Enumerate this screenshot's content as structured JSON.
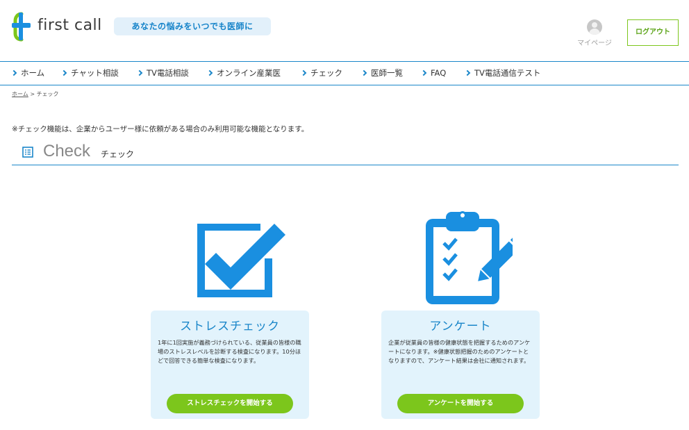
{
  "header": {
    "logo_text": "first call",
    "tagline": "あなたの悩みをいつでも医師に",
    "mypage_label": "マイページ",
    "logout_label": "ログアウト"
  },
  "nav": {
    "items": [
      {
        "label": "ホーム"
      },
      {
        "label": "チャット相談"
      },
      {
        "label": "TV電話相談"
      },
      {
        "label": "オンライン産業医"
      },
      {
        "label": "チェック"
      },
      {
        "label": "医師一覧"
      },
      {
        "label": "FAQ"
      },
      {
        "label": "TV電話通信テスト"
      }
    ]
  },
  "breadcrumb": {
    "home": "ホーム",
    "separator": ">",
    "current": "チェック"
  },
  "notice": "※チェック機能は、企業からユーザー様に依頼がある場合のみ利用可能な機能となります。",
  "section": {
    "title_en": "Check",
    "title_ja": "チェック"
  },
  "cards": [
    {
      "title": "ストレスチェック",
      "description": "1年に1回実施が義務づけられている、従業員の皆様の職場のストレスレベルを診断する検査になります。10分ほどで回答できる簡単な検査になります。",
      "button_label": "ストレスチェックを開始する",
      "icon": "checkbox-icon"
    },
    {
      "title": "アンケート",
      "description": "企業が従業員の皆様の健康状態を把握するためのアンケートになります。※健康状態把握のためのアンケートとなりますので、アンケート結果は会社に通知されます。",
      "button_label": "アンケートを開始する",
      "icon": "clipboard-icon"
    }
  ],
  "colors": {
    "primary_blue": "#1a86c9",
    "icon_blue": "#1a8fe0",
    "green": "#7cc61c",
    "card_bg": "#e2f3fc",
    "tagline_bg": "#e2f0fa"
  }
}
